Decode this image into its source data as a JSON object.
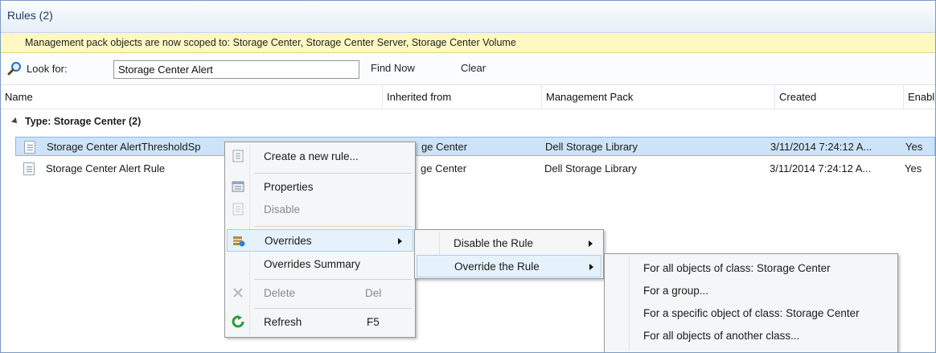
{
  "title": "Rules (2)",
  "info_message": "Management pack objects are now scoped to: Storage Center, Storage Center Server, Storage Center Volume",
  "search": {
    "look_for_label": "Look for:",
    "value": "Storage Center Alert",
    "find_now": "Find Now",
    "clear": "Clear"
  },
  "columns": [
    "Name",
    "Inherited from",
    "Management Pack",
    "Created",
    "Enabl"
  ],
  "group_label": "Type: Storage Center (2)",
  "rows": [
    {
      "name": "Storage Center AlertThresholdSp",
      "inherited": "ge Center",
      "mp": "Dell Storage Library",
      "created": "3/11/2014 7:24:12 A...",
      "enabled": "Yes"
    },
    {
      "name": "Storage Center Alert Rule",
      "inherited": "ge Center",
      "mp": "Dell Storage Library",
      "created": "3/11/2014 7:24:12 A...",
      "enabled": "Yes"
    }
  ],
  "context_menu": {
    "create": "Create a new rule...",
    "properties": "Properties",
    "disable": "Disable",
    "overrides": "Overrides",
    "overrides_summary": "Overrides Summary",
    "delete": "Delete",
    "delete_shortcut": "Del",
    "refresh": "Refresh",
    "refresh_shortcut": "F5"
  },
  "overrides_menu": {
    "disable_rule": "Disable the Rule",
    "override_rule": "Override the Rule"
  },
  "override_rule_menu": {
    "all_class": "For all objects of class: Storage Center",
    "group": "For a group...",
    "specific": "For a specific object of class: Storage Center",
    "another": "For all objects of another class..."
  },
  "colors": {
    "selection": "#cde3f7",
    "info_bar": "#fff8c2",
    "menu_bg": "#f5f6f7",
    "menu_highlight": "#e5f1fb"
  },
  "icons": [
    "search-icon",
    "rule-icon",
    "properties-icon",
    "overrides-icon",
    "delete-icon",
    "refresh-icon",
    "submenu-arrow-icon"
  ]
}
